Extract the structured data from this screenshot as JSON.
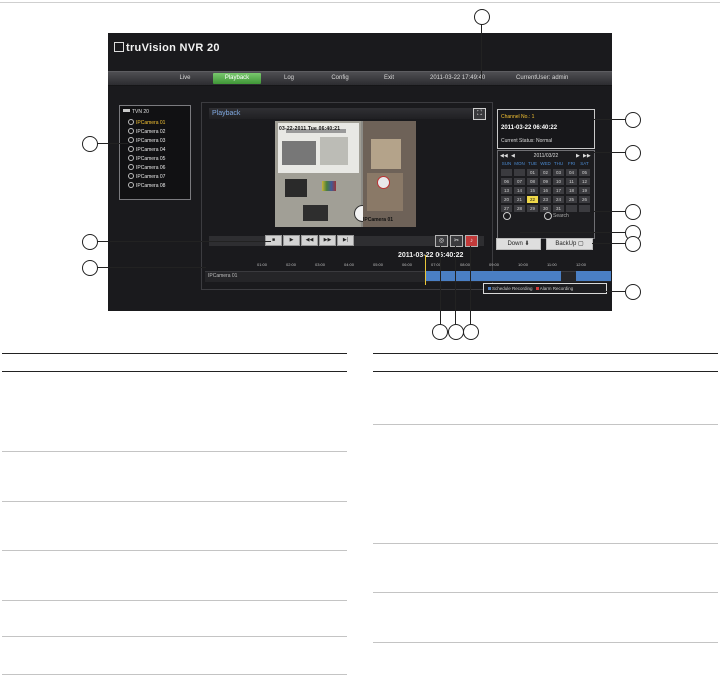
{
  "app": {
    "brand": "truVision NVR 20"
  },
  "nav": {
    "items": [
      "Live",
      "Playback",
      "Log",
      "Config",
      "Exit"
    ],
    "active": "Playback",
    "datetime": "2011-03-22 17:49:40",
    "user": "CurrentUser: admin"
  },
  "tree": {
    "root": "TVN 20",
    "cameras": [
      "IPCamera 01",
      "IPCamera 02",
      "IPCamera 03",
      "IPCamera 04",
      "IPCamera 05",
      "IPCamera 06",
      "IPCamera 07",
      "IPCamera 08"
    ],
    "selected_index": 0
  },
  "playback": {
    "title": "Playback",
    "video_osd": "03-22-2011 Tue 06:40:21",
    "video_camera_label": "IPCamera 01",
    "timestamp": "2011-03-22 06:40:22",
    "track_label": "IPCamera 01",
    "ruler_ticks": [
      "01:00",
      "02:00",
      "03:00",
      "04:00",
      "05:00",
      "06:00",
      "07:00",
      "08:00",
      "09:00",
      "10:00",
      "11:00",
      "12:00"
    ]
  },
  "info": {
    "channel": "Channel No.: 1",
    "datetime": "2011-03-22 06:40:22",
    "status": "Current Status: Normal"
  },
  "calendar": {
    "month_label": "2011/03/22",
    "weekdays": [
      "SUN",
      "MON",
      "TUE",
      "WED",
      "THU",
      "FRI",
      "SAT"
    ],
    "days": [
      "",
      "",
      "01",
      "02",
      "03",
      "04",
      "05",
      "06",
      "07",
      "08",
      "09",
      "10",
      "11",
      "12",
      "13",
      "14",
      "15",
      "16",
      "17",
      "18",
      "19",
      "20",
      "21",
      "22",
      "23",
      "24",
      "25",
      "26",
      "27",
      "28",
      "29",
      "30",
      "31",
      "",
      ""
    ],
    "highlight": "22",
    "search_label": "Search"
  },
  "buttons": {
    "download": "Down",
    "backup": "BackUp"
  },
  "legend": {
    "schedule": "Schedule Recording",
    "alarm": "Alarm Recording",
    "schedule_color": "#4a7fc4",
    "alarm_color": "#d23a3a"
  },
  "colors": {
    "active_tab": "#4fa845",
    "accent_yellow": "#f3c133"
  }
}
